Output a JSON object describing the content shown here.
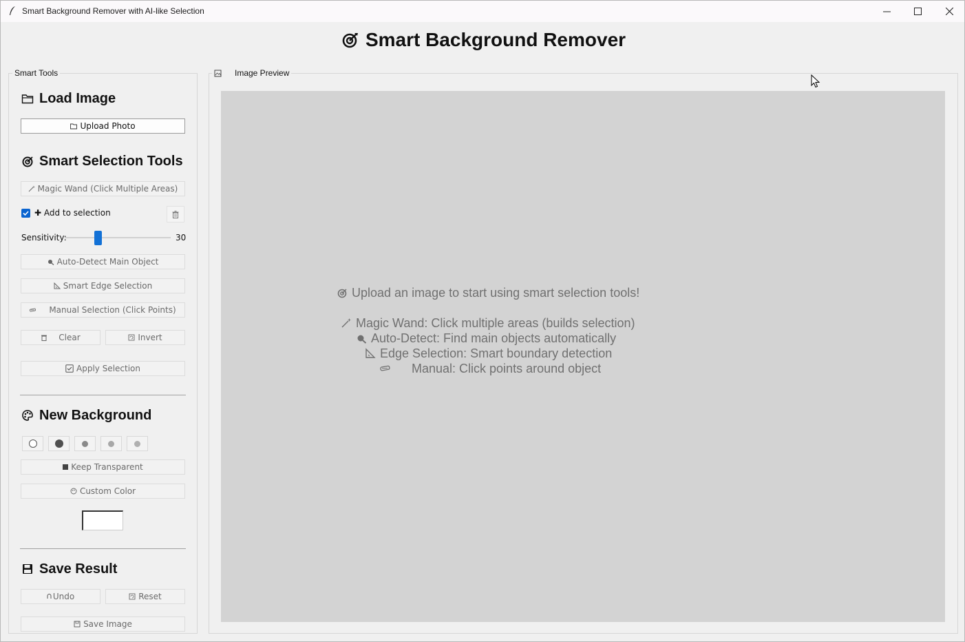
{
  "window": {
    "title": "Smart Background Remover with AI-like Selection",
    "app_title": "Smart Background Remover"
  },
  "sidebar": {
    "group_label": "Smart Tools",
    "load_image": {
      "title": "Load Image",
      "upload_button": "Upload Photo"
    },
    "selection_tools": {
      "title": "Smart Selection Tools",
      "magic_wand_button": "Magic Wand (Click Multiple Areas)",
      "add_to_selection_label": "✚ Add to selection",
      "add_to_selection_checked": true,
      "sensitivity_label": "Sensitivity:",
      "sensitivity_value": "30",
      "sensitivity_fraction": 0.3,
      "auto_detect_button": "Auto-Detect Main Object",
      "edge_selection_button": "Smart Edge Selection",
      "manual_selection_button": "Manual Selection (Click Points)",
      "clear_button": "Clear",
      "invert_button": "Invert",
      "apply_button": "Apply Selection"
    },
    "background": {
      "title": "New Background",
      "swatches": [
        {
          "name": "white",
          "color": "#ffffff"
        },
        {
          "name": "dark-gray",
          "color": "#505050"
        },
        {
          "name": "gray",
          "color": "#8a8a8a"
        },
        {
          "name": "light-gray",
          "color": "#a8a8a8"
        },
        {
          "name": "silver",
          "color": "#b0b0b0"
        }
      ],
      "transparent_button": "Keep Transparent",
      "custom_color_button": "Custom Color",
      "custom_color_value": "#ffffff"
    },
    "save": {
      "title": "Save Result",
      "undo_button": "Undo",
      "reset_button": "Reset",
      "save_button": "Save Image"
    }
  },
  "preview": {
    "group_label": "Image Preview",
    "placeholder_title": "Upload an image to start using smart selection tools!",
    "tips": [
      "Magic Wand: Click multiple areas (builds selection)",
      "Auto-Detect: Find main objects automatically",
      "Edge Selection: Smart boundary detection",
      "Manual: Click points around object"
    ]
  }
}
